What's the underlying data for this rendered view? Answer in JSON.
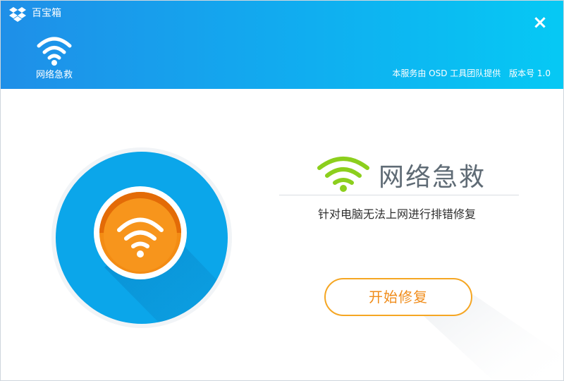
{
  "app": {
    "title": "百宝箱"
  },
  "header": {
    "tool_label": "网络急救",
    "credit": "本服务由 OSD 工具团队提供",
    "version": "版本号 1.0",
    "close": "×"
  },
  "main": {
    "title": "网络急救",
    "description": "针对电脑无法上网进行排错修复",
    "start_button": "开始修复"
  },
  "colors": {
    "header_start": "#1f8fe8",
    "header_end": "#06c9f4",
    "hero_blue": "#0ba6ea",
    "hero_orange": "#f38c14",
    "wifi_green": "#8ccf1d",
    "button_border": "#f5a623",
    "button_text": "#f08c1a"
  },
  "icons": [
    "dropbox-icon",
    "wifi-icon",
    "close-icon"
  ]
}
